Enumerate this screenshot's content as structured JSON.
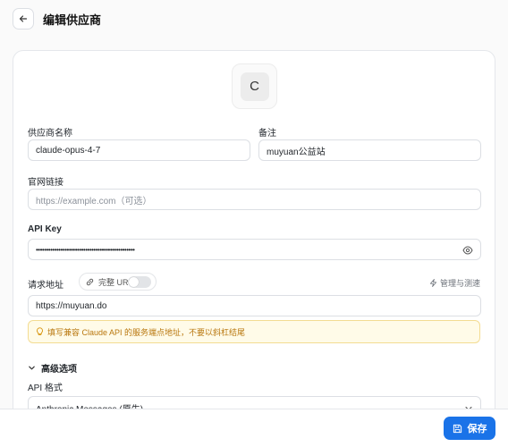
{
  "header": {
    "title": "编辑供应商",
    "back_icon": "arrow-left-icon"
  },
  "logo": {
    "letter": "C"
  },
  "form": {
    "name_label": "供应商名称",
    "name_value": "claude-opus-4-7",
    "note_label": "备注",
    "note_value": "muyuan公益站",
    "website_label": "官网链接",
    "website_placeholder": "https://example.com（可选）",
    "apikey_label": "API Key",
    "apikey_value": "••••••••••••••••••••••••••••••••••••••••••••••••",
    "endpoint_label": "请求地址",
    "full_url_label": "完整 URL",
    "full_url_enabled": false,
    "manage_label": "管理与测速",
    "endpoint_value": "https://muyuan.do",
    "hint": "填写兼容 Claude API 的服务端点地址，不要以斜杠结尾",
    "advanced_label": "高级选项",
    "api_format_label": "API 格式",
    "api_format_value": "Anthropic Messages (原生)"
  },
  "footer": {
    "save_label": "保存"
  },
  "colors": {
    "accent": "#1a73e8",
    "hint_bg": "#fffbe8",
    "hint_text": "#b9770e"
  }
}
